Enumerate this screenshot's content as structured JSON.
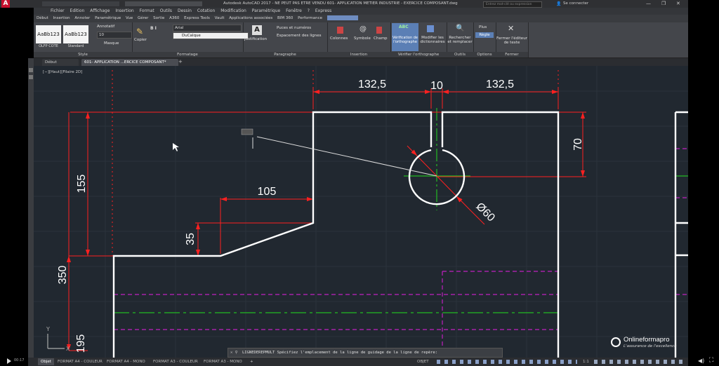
{
  "title_bar": {
    "title": "Autodesk AutoCAD 2017 - NE PEUT PAS ETRE VENDU    601- APPLICATION METIER INDUSTRIE - EXERCICE COMPOSANT.dwg",
    "search_placeholder": "Entrez mot-clé ou expression",
    "signin": "Se connecter"
  },
  "menu": [
    "Fichier",
    "Edition",
    "Affichage",
    "Insertion",
    "Format",
    "Outils",
    "Dessin",
    "Cotation",
    "Modification",
    "Paramétrique",
    "Fenêtre",
    "?",
    "Express"
  ],
  "ribbon_tabs": [
    "Début",
    "Insertion",
    "Annoter",
    "Paramétrique",
    "Vue",
    "Gérer",
    "Sortie",
    "A360",
    "Express Tools",
    "Vault",
    "Applications associées",
    "BIM 360",
    "Performance"
  ],
  "ribbon": {
    "style": {
      "label": "Style",
      "style1": "AaBb123",
      "style1_name": "OLFP COTE",
      "style2": "AaBb123",
      "style2_name": "Standard",
      "annotatif": "Annotatif",
      "size": "10",
      "masque": "Masque"
    },
    "formatage": {
      "label": "Formatage",
      "copier": "Copier",
      "font": "Arial",
      "layer": "DuCalque"
    },
    "paragraphe": {
      "label": "Paragraphe",
      "justification": "Justification",
      "puces": "Puces et numéros",
      "espacement": "Espacement des lignes"
    },
    "insertion": {
      "label": "Insertion",
      "colonnes": "Colonnes",
      "symbole": "Symbole",
      "champ": "Champ"
    },
    "orthographe": {
      "label": "Vérifier l'orthographe",
      "verif": "Vérification de l'orthographe",
      "modifier": "Modifier les dictionnaires"
    },
    "outils": {
      "label": "Outils",
      "rechercher": "Rechercher et remplacer"
    },
    "options": {
      "label": "Options",
      "plus": "Plus",
      "regle": "Règle"
    },
    "fermer": {
      "label": "Fermer",
      "btn": "Fermer l'éditeur de texte"
    }
  },
  "doc_tabs": [
    "Début",
    "601- APPLICATION ...ERCICE COMPOSANT*"
  ],
  "viewport_label": "[−][Haut][Filaire 2D]",
  "dimensions": {
    "d1": "132,5",
    "d2": "10",
    "d3": "132,5",
    "d4": "70",
    "d5": "155",
    "d6": "105",
    "d7": "35",
    "d8": "Ø60",
    "d9": "350",
    "d10": "195"
  },
  "command_line": "LIGNEDEREPMULT Spécifiez l'emplacement de la ligne de guidage de la ligne de repère:",
  "layout_tabs": [
    "Objet",
    "FORMAT A4 - COULEUR",
    "FORMAT A4 - MONO",
    "FORMAT A3 - COULEUR",
    "FORMAT A3 - MONO"
  ],
  "status": {
    "objet": "OBJET",
    "scale": "1:1"
  },
  "watermark": {
    "brand": "Onlineformapro",
    "tagline": "L'assurance de l'excellence"
  },
  "player": {
    "time": "00:17"
  },
  "ucs": {
    "x": "X",
    "y": "Y"
  },
  "colors": {
    "canvas": "#212830",
    "dim": "#ff2020",
    "geometry": "#ffffff",
    "center": "#22bb22",
    "hidden": "#c020c0"
  }
}
